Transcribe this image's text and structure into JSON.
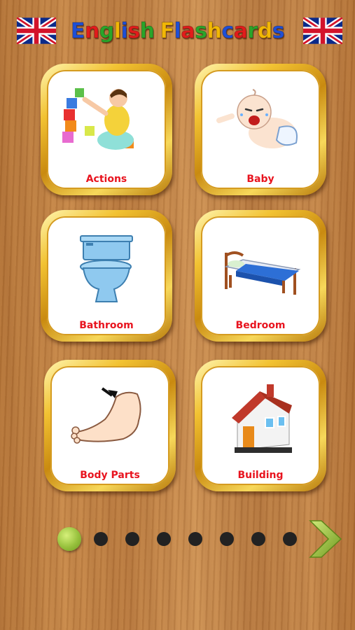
{
  "header": {
    "title_letters": [
      {
        "ch": "E",
        "color": "#1f4fd6"
      },
      {
        "ch": "n",
        "color": "#e21b1b"
      },
      {
        "ch": "g",
        "color": "#2aa52a"
      },
      {
        "ch": "l",
        "color": "#f2b705"
      },
      {
        "ch": "i",
        "color": "#1f4fd6"
      },
      {
        "ch": "s",
        "color": "#e21b1b"
      },
      {
        "ch": "h",
        "color": "#2aa52a"
      },
      {
        "ch": " ",
        "color": "#000000"
      },
      {
        "ch": "F",
        "color": "#f2b705"
      },
      {
        "ch": "l",
        "color": "#1f4fd6"
      },
      {
        "ch": "a",
        "color": "#e21b1b"
      },
      {
        "ch": "s",
        "color": "#2aa52a"
      },
      {
        "ch": "h",
        "color": "#f2b705"
      },
      {
        "ch": "c",
        "color": "#1f4fd6"
      },
      {
        "ch": "a",
        "color": "#e21b1b"
      },
      {
        "ch": "r",
        "color": "#2aa52a"
      },
      {
        "ch": "d",
        "color": "#f2b705"
      },
      {
        "ch": "s",
        "color": "#1f4fd6"
      }
    ]
  },
  "categories": [
    {
      "label": "Actions",
      "icon": "baby-playing-blocks-icon"
    },
    {
      "label": "Baby",
      "icon": "crying-baby-icon"
    },
    {
      "label": "Bathroom",
      "icon": "toilet-icon"
    },
    {
      "label": "Bedroom",
      "icon": "bed-icon"
    },
    {
      "label": "Body Parts",
      "icon": "foot-icon"
    },
    {
      "label": "Building",
      "icon": "house-icon"
    }
  ],
  "pagination": {
    "total_pages": 8,
    "current_page": 1
  },
  "colors": {
    "label": "#e8141f",
    "active_dot": "#97c13d",
    "arrow": "#8fbf3a"
  }
}
